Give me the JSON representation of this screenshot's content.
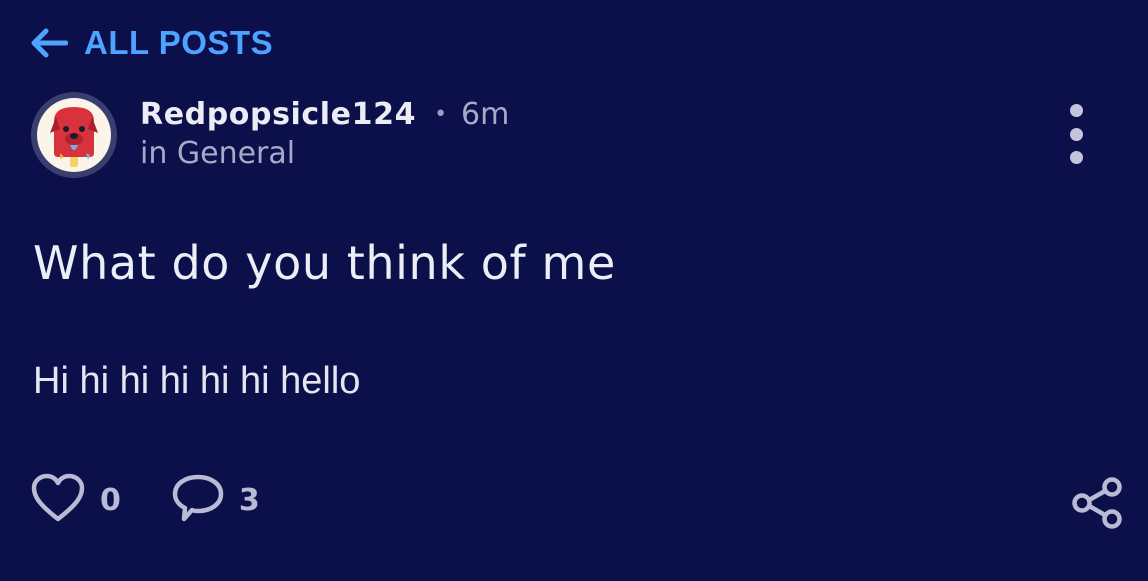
{
  "nav": {
    "back_label": "ALL POSTS",
    "back_icon": "arrow-left-icon"
  },
  "post": {
    "author": "Redpopsicle124",
    "separator": "•",
    "time_ago": "6m",
    "category": "in General",
    "title": "What do you think of me",
    "body": "Hi hi hi hi hi hi hello",
    "likes": "0",
    "comments": "3"
  },
  "icons": {
    "avatar": "red-dog-popsicle-avatar",
    "more": "more-vertical-icon",
    "like": "heart-icon",
    "comment": "comment-bubble-icon",
    "share": "share-icon"
  },
  "colors": {
    "background": "#0b0f4a",
    "accent": "#4da3ff",
    "text_primary": "#ececf4",
    "text_secondary": "#a7a9c8"
  }
}
